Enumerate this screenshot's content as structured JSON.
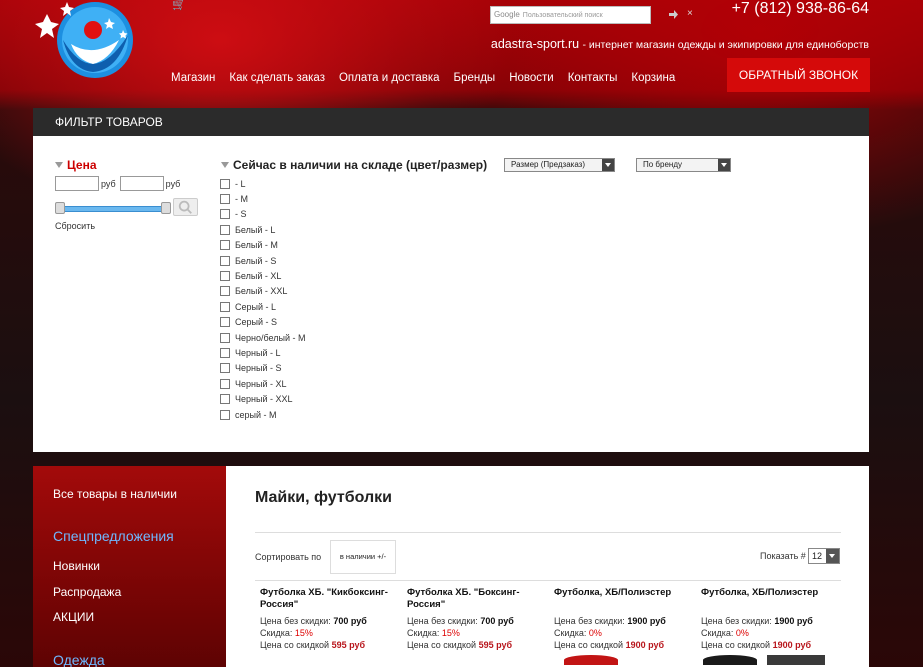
{
  "header": {
    "phone": "+7 (812) 938-86-64",
    "site": "adastra-sport.ru",
    "tagline": "- интернет магазин одежды и экипировки для единоборств",
    "search": {
      "brand": "Google",
      "placeholder": "Пользовательский поиск"
    },
    "callback_label": "ОБРАТНЫЙ ЗВОНОК",
    "nav": [
      "Магазин",
      "Как сделать заказ",
      "Оплата и доставка",
      "Бренды",
      "Новости",
      "Контакты",
      "Корзина"
    ]
  },
  "filter": {
    "title": "ФИЛЬТР ТОВАРОВ",
    "price": {
      "label": "Цена",
      "currency_from": "руб",
      "currency_to": "руб",
      "reset_label": "Сбросить"
    },
    "stock": {
      "label": "Сейчас в наличии на складе (цвет/размер)",
      "options": [
        "- L",
        "- M",
        "- S",
        "Белый - L",
        "Белый - M",
        "Белый - S",
        "Белый - XL",
        "Белый - XXL",
        "Серый - L",
        "Серый - S",
        "Черно/белый - M",
        "Черный - L",
        "Черный - S",
        "Черный - XL",
        "Черный - XXL",
        "серый - M"
      ]
    },
    "size_select": "Размер (Предзаказ)",
    "brand_select": "По бренду"
  },
  "sidebar": {
    "all_items": "Все товары в наличии",
    "special_heading": "Спецпредложения",
    "items": [
      "Новинки",
      "Распродажа",
      "АКЦИИ"
    ],
    "clothes_heading": "Одежда"
  },
  "catalog": {
    "title": "Майки, футболки",
    "sort_label": "Сортировать по",
    "sort_value": "в наличии +/-",
    "show_label": "Показать #",
    "show_value": "12",
    "products": [
      {
        "name": "Футболка ХБ. \"Кикбоксинг-Россия\"",
        "price_label": "Цена без скидки:",
        "price": "700 руб",
        "discount_label": "Скидка:",
        "discount": "15%",
        "final_label": "Цена со скидкой",
        "final": "595 руб"
      },
      {
        "name": "Футболка ХБ. \"Боксинг-Россия\"",
        "price_label": "Цена без скидки:",
        "price": "700 руб",
        "discount_label": "Скидка:",
        "discount": "15%",
        "final_label": "Цена со скидкой",
        "final": "595 руб"
      },
      {
        "name": "Футболка, ХБ/Полиэстер",
        "price_label": "Цена без скидки:",
        "price": "1900 руб",
        "discount_label": "Скидка:",
        "discount": "0%",
        "final_label": "Цена со скидкой",
        "final": "1900 руб"
      },
      {
        "name": "Футболка, ХБ/Полиэстер",
        "price_label": "Цена без скидки:",
        "price": "1900 руб",
        "discount_label": "Скидка:",
        "discount": "0%",
        "final_label": "Цена со скидкой",
        "final": "1900 руб"
      }
    ]
  }
}
